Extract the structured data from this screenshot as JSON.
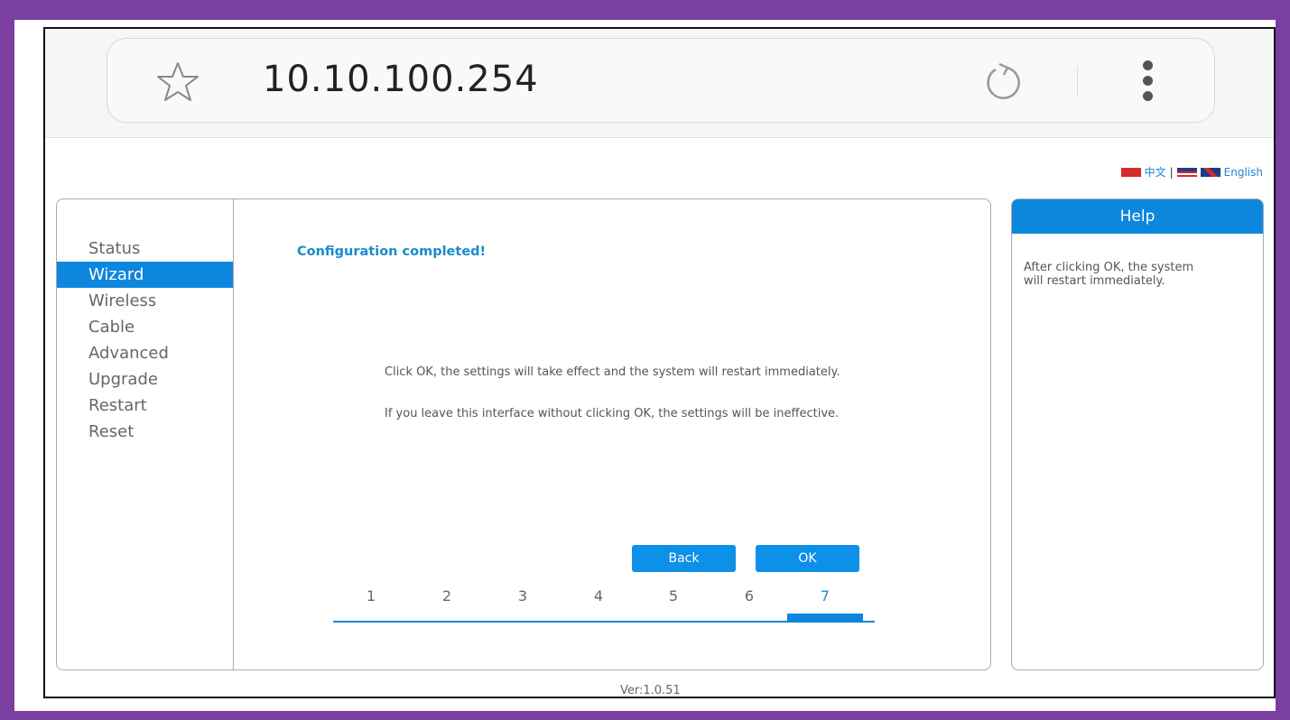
{
  "browser": {
    "url": "10.10.100.254"
  },
  "language": {
    "chinese_label": "中文",
    "separator": "|",
    "english_label": "English"
  },
  "sidebar": {
    "items": [
      {
        "label": "Status"
      },
      {
        "label": "Wizard"
      },
      {
        "label": "Wireless"
      },
      {
        "label": "Cable"
      },
      {
        "label": "Advanced"
      },
      {
        "label": "Upgrade"
      },
      {
        "label": "Restart"
      },
      {
        "label": "Reset"
      }
    ],
    "active_index": 1
  },
  "main": {
    "title": "Configuration completed!",
    "message_1": "Click OK, the settings will take effect and the system will restart immediately.",
    "message_2": "If you leave this interface without clicking OK, the settings will be ineffective.",
    "back_label": "Back",
    "ok_label": "OK",
    "steps": [
      "1",
      "2",
      "3",
      "4",
      "5",
      "6",
      "7"
    ],
    "current_step": 7
  },
  "help": {
    "title": "Help",
    "text": "After clicking OK, the system will restart immediately."
  },
  "footer": {
    "version": "Ver:1.0.51"
  },
  "colors": {
    "accent": "#0d86de",
    "title_blue": "#1b8bc9",
    "outer_border": "#7a3fa0"
  }
}
